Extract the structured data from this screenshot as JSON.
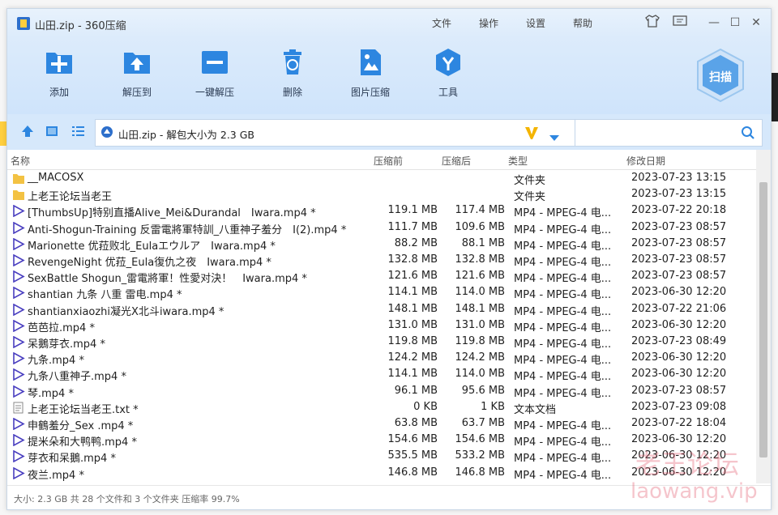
{
  "window": {
    "title": "山田.zip - 360压缩"
  },
  "menu": {
    "file": "文件",
    "action": "操作",
    "settings": "设置",
    "help": "帮助"
  },
  "controls": {
    "skin": "skin-icon",
    "feedback": "feedback-icon",
    "minimize": "—",
    "maximize": "☐",
    "close": "✕"
  },
  "toolbar": {
    "add": "添加",
    "extract_to": "解压到",
    "one_click_extract": "一键解压",
    "delete": "删除",
    "image_compress": "图片压缩",
    "tools": "工具",
    "scan": "扫描"
  },
  "address": {
    "text": "山田.zip - 解包大小为 2.3 GB",
    "search_placeholder": ""
  },
  "columns": {
    "name": "名称",
    "compressed_before": "压缩前",
    "compressed_after": "压缩后",
    "type": "类型",
    "modified": "修改日期"
  },
  "files": [
    {
      "name": "__MACOSX",
      "size": "",
      "packed": "",
      "type": "文件夹",
      "date": "2023-07-23 13:15",
      "icon": "folder-icon"
    },
    {
      "name": "上老王论坛当老王",
      "size": "",
      "packed": "",
      "type": "文件夹",
      "date": "2023-07-23 13:15",
      "icon": "folder-icon"
    },
    {
      "name": "[ThumbsUp]特别直播Alive_Mei&Durandal　Iwara.mp4 *",
      "size": "119.1 MB",
      "packed": "117.4 MB",
      "type": "MP4 - MPEG-4 电...",
      "date": "2023-07-22 20:18",
      "icon": "video-icon"
    },
    {
      "name": "Anti-Shogun-Training 反雷電將軍特訓_八重神子羞分　I(2).mp4 *",
      "size": "111.7 MB",
      "packed": "109.6 MB",
      "type": "MP4 - MPEG-4 电...",
      "date": "2023-07-23 08:57",
      "icon": "video-icon"
    },
    {
      "name": "Marionette 优菈败北_Eulaエウルア　Iwara.mp4 *",
      "size": "88.2 MB",
      "packed": "88.1 MB",
      "type": "MP4 - MPEG-4 电...",
      "date": "2023-07-23 08:57",
      "icon": "video-icon"
    },
    {
      "name": "RevengeNight 优菈_Eula復仇之夜　Iwara.mp4 *",
      "size": "132.8 MB",
      "packed": "132.8 MB",
      "type": "MP4 - MPEG-4 电...",
      "date": "2023-07-23 08:57",
      "icon": "video-icon"
    },
    {
      "name": "SexBattle Shogun_雷電將軍！性愛对決！　Iwara.mp4 *",
      "size": "121.6 MB",
      "packed": "121.6 MB",
      "type": "MP4 - MPEG-4 电...",
      "date": "2023-07-23 08:57",
      "icon": "video-icon"
    },
    {
      "name": "shantian 九条 八重 雷电.mp4 *",
      "size": "114.1 MB",
      "packed": "114.0 MB",
      "type": "MP4 - MPEG-4 电...",
      "date": "2023-06-30 12:20",
      "icon": "video-icon"
    },
    {
      "name": "shantianxiaozhi凝光X北斗iwara.mp4 *",
      "size": "148.1 MB",
      "packed": "148.1 MB",
      "type": "MP4 - MPEG-4 电...",
      "date": "2023-07-22 21:06",
      "icon": "video-icon"
    },
    {
      "name": "芭芭拉.mp4 *",
      "size": "131.0 MB",
      "packed": "131.0 MB",
      "type": "MP4 - MPEG-4 电...",
      "date": "2023-06-30 12:20",
      "icon": "video-icon"
    },
    {
      "name": "呆鵝芽衣.mp4 *",
      "size": "119.8 MB",
      "packed": "119.8 MB",
      "type": "MP4 - MPEG-4 电...",
      "date": "2023-07-23 08:49",
      "icon": "video-icon"
    },
    {
      "name": "九条.mp4 *",
      "size": "124.2 MB",
      "packed": "124.2 MB",
      "type": "MP4 - MPEG-4 电...",
      "date": "2023-06-30 12:20",
      "icon": "video-icon"
    },
    {
      "name": "九条八重神子.mp4 *",
      "size": "114.1 MB",
      "packed": "114.0 MB",
      "type": "MP4 - MPEG-4 电...",
      "date": "2023-06-30 12:20",
      "icon": "video-icon"
    },
    {
      "name": "琴.mp4 *",
      "size": "96.1 MB",
      "packed": "95.6 MB",
      "type": "MP4 - MPEG-4 电...",
      "date": "2023-07-23 08:57",
      "icon": "video-icon"
    },
    {
      "name": "上老王论坛当老王.txt *",
      "size": "0 KB",
      "packed": "1 KB",
      "type": "文本文档",
      "date": "2023-07-23 09:08",
      "icon": "text-file-icon"
    },
    {
      "name": "申鶴羞分_Sex .mp4 *",
      "size": "63.8 MB",
      "packed": "63.7 MB",
      "type": "MP4 - MPEG-4 电...",
      "date": "2023-07-22 18:04",
      "icon": "video-icon"
    },
    {
      "name": "提米朵和大鸭鸭.mp4 *",
      "size": "154.6 MB",
      "packed": "154.6 MB",
      "type": "MP4 - MPEG-4 电...",
      "date": "2023-06-30 12:20",
      "icon": "video-icon"
    },
    {
      "name": "芽衣和呆鵝.mp4 *",
      "size": "535.5 MB",
      "packed": "533.2 MB",
      "type": "MP4 - MPEG-4 电...",
      "date": "2023-06-30 12:20",
      "icon": "video-icon"
    },
    {
      "name": "夜兰.mp4 *",
      "size": "146.8 MB",
      "packed": "146.8 MB",
      "type": "MP4 - MPEG-4 电...",
      "date": "2023-06-30 12:20",
      "icon": "video-icon"
    }
  ],
  "status": {
    "text": "大小: 2.3 GB 共 28 个文件和 3 个文件夹 压缩率 99.7%"
  },
  "watermark": {
    "line1": "老王论坛",
    "line2": "laowang.vip"
  },
  "colors": {
    "accent": "#2d86e0",
    "toolbar_bg": "#d3e6fb",
    "scan_badge": "#5aa3e8",
    "v_logo": "#f4b400"
  }
}
